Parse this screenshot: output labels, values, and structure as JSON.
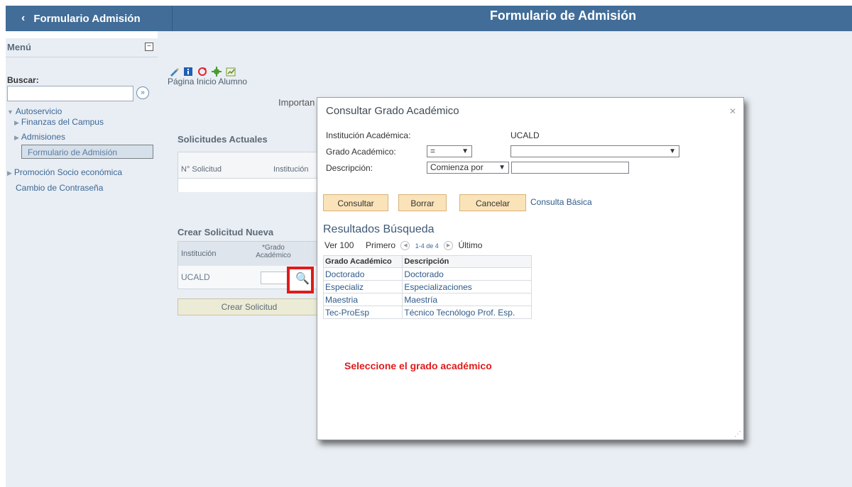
{
  "header": {
    "back_label": "Formulario Admisión",
    "title": "Formulario de Admisión"
  },
  "sidebar": {
    "menu_label": "Menú",
    "search_label": "Buscar:",
    "items": [
      {
        "label": "Autoservicio"
      },
      {
        "label": "Finanzas del Campus"
      },
      {
        "label": "Admisiones"
      },
      {
        "label": "Formulario de Admisión"
      },
      {
        "label": "Promoción Socio económica"
      },
      {
        "label": "Cambio de Contraseña"
      }
    ]
  },
  "main": {
    "pagina": "Página Inicio Alumno",
    "importan": "Importan",
    "solicitudes_actuales": "Solicitudes Actuales",
    "sol_col1": "N° Solicitud",
    "sol_col2": "Institución",
    "crear_header": "Crear Solicitud Nueva",
    "crear_col1": "Institución",
    "crear_col2": "*Grado Académico",
    "crear_inst_value": "UCALD",
    "crear_button": "Crear Solicitud"
  },
  "modal": {
    "title": "Consultar Grado Académico",
    "inst_label": "Institución Académica:",
    "inst_value": "UCALD",
    "grado_label": "Grado Académico:",
    "grado_op": "=",
    "desc_label": "Descripción:",
    "desc_op": "Comienza por",
    "btn_consultar": "Consultar",
    "btn_borrar": "Borrar",
    "btn_cancelar": "Cancelar",
    "consulta_basica": "Consulta Básica",
    "results_title": "Resultados Búsqueda",
    "pager": {
      "ver": "Ver 100",
      "primero": "Primero",
      "count": "1-4 de 4",
      "ultimo": "Último"
    },
    "columns": [
      "Grado Académico",
      "Descripción"
    ],
    "rows": [
      [
        "Doctorado",
        "Doctorado"
      ],
      [
        "Especializ",
        "Especializaciones"
      ],
      [
        "Maestria",
        "Maestría"
      ],
      [
        "Tec-ProEsp",
        "Técnico Tecnólogo Prof. Esp."
      ]
    ],
    "instruction": "Seleccione el grado académico"
  },
  "colors": {
    "header_bg": "#416d98",
    "panel_bg": "#e9eef4",
    "highlight": "#e01b1b",
    "button_bg": "#fbe3b9"
  }
}
